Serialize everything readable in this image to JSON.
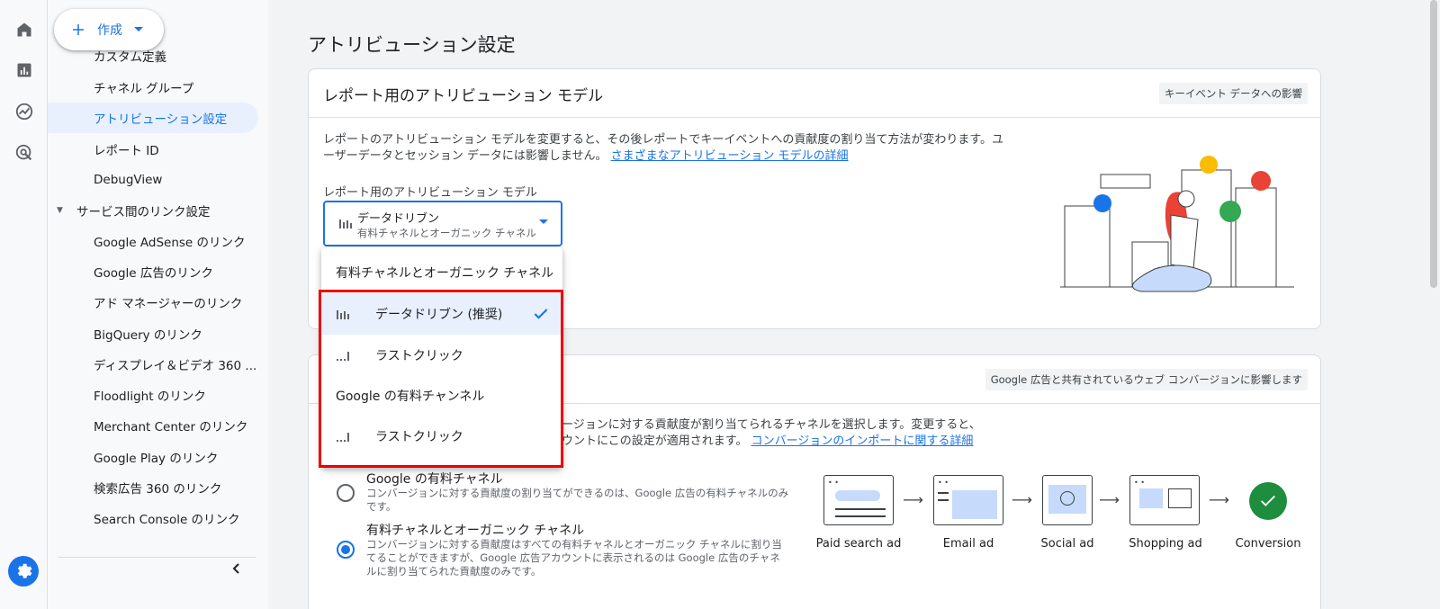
{
  "create_button": {
    "label": "作成"
  },
  "nav": {
    "items": [
      {
        "label": "カスタム定義"
      },
      {
        "label": "チャネル グループ"
      },
      {
        "label": "アトリビューション設定"
      },
      {
        "label": "レポート ID"
      },
      {
        "label": "DebugView"
      }
    ],
    "section": {
      "label": "サービス間のリンク設定"
    },
    "links": [
      {
        "label": "Google AdSense のリンク"
      },
      {
        "label": "Google 広告のリンク"
      },
      {
        "label": "アド マネージャーのリンク"
      },
      {
        "label": "BigQuery のリンク"
      },
      {
        "label": "ディスプレイ＆ビデオ 360 ..."
      },
      {
        "label": "Floodlight のリンク"
      },
      {
        "label": "Merchant Center のリンク"
      },
      {
        "label": "Google Play のリンク"
      },
      {
        "label": "検索広告 360 のリンク"
      },
      {
        "label": "Search Console のリンク"
      }
    ]
  },
  "page": {
    "title": "アトリビューション設定"
  },
  "card1": {
    "title": "レポート用のアトリビューション モデル",
    "chip": "キーイベント データへの影響",
    "desc_line1": "レポートのアトリビューション モデルを変更すると、その後レポートでキーイベントへの貢献度の割り当て方法が変わります。ユ",
    "desc_line2": "ーザーデータとセッション データには影響しません。",
    "desc_link": "さまざまなアトリビューション モデルの詳細",
    "field_label": "レポート用のアトリビューション モデル",
    "select_value": "データドリブン",
    "select_sub": "有料チャネルとオーガニック チャネル"
  },
  "card2": {
    "chip": "Google 広告と共有されているウェブ コンバージョンに影響します",
    "desc_line1": "ージョンに対する貢献度が割り当てられるチャネルを選択します。変更すると、",
    "desc_line2": "ウントにこの設定が適用されます。",
    "desc_link": "コンバージョンのインポートに関する詳細",
    "options": [
      {
        "title": "Google の有料チャネル",
        "desc": "コンバージョンに対する貢献度の割り当てができるのは、Google 広告の有料チャネルのみです。"
      },
      {
        "title": "有料チャネルとオーガニック チャネル",
        "desc": "コンバージョンに対する貢献度はすべての有料チャネルとオーガニック チャネルに割り当てることができますが、Google 広告アカウントに表示されるのは Google 広告のチャネルに割り当てられた貢献度のみです。"
      }
    ],
    "flow": [
      "Paid search ad",
      "Email ad",
      "Social ad",
      "Shopping ad",
      "Conversion"
    ]
  },
  "dropdown": {
    "group1": "有料チャネルとオーガニック チャネル",
    "item1": "データドリブン (推奨)",
    "item2": "ラストクリック",
    "group2": "Google の有料チャンネル",
    "item3": "ラストクリック"
  },
  "colors": {
    "accent": "#1a73e8",
    "highlight": "#ee0000",
    "success": "#1e8e3e"
  }
}
